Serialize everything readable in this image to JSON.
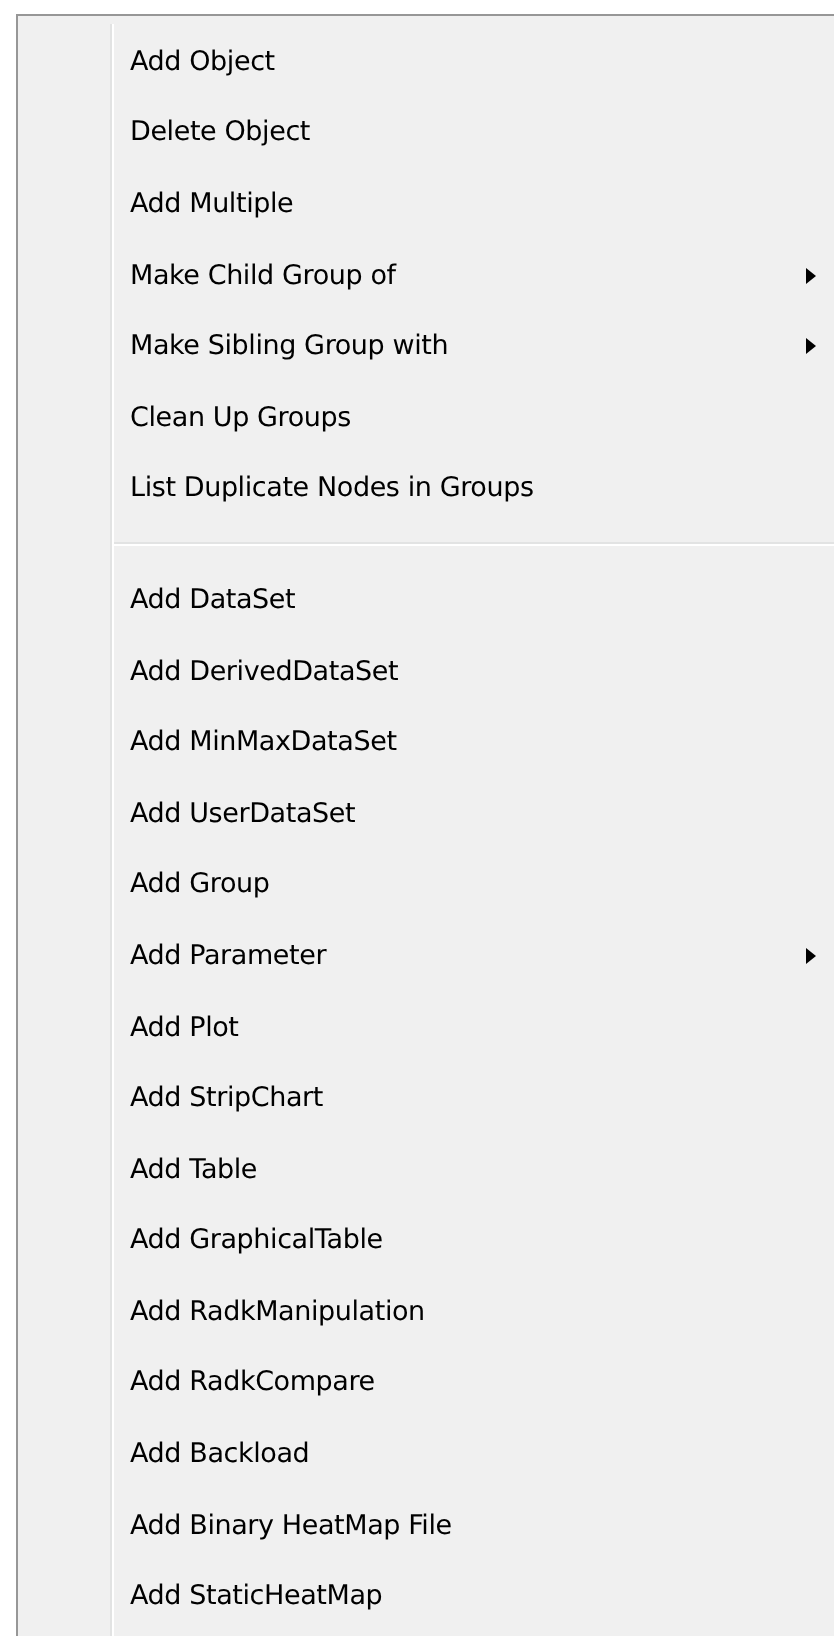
{
  "context_menu": {
    "groups": [
      {
        "items": [
          {
            "label": "Add Object",
            "submenu": false
          },
          {
            "label": "Delete Object",
            "submenu": false
          },
          {
            "label": "Add Multiple",
            "submenu": false
          },
          {
            "label": "Make Child Group of",
            "submenu": true
          },
          {
            "label": "Make Sibling Group with",
            "submenu": true
          },
          {
            "label": "Clean Up Groups",
            "submenu": false
          },
          {
            "label": "List Duplicate Nodes in Groups",
            "submenu": false
          }
        ]
      },
      {
        "items": [
          {
            "label": "Add DataSet",
            "submenu": false
          },
          {
            "label": "Add DerivedDataSet",
            "submenu": false
          },
          {
            "label": "Add MinMaxDataSet",
            "submenu": false
          },
          {
            "label": "Add UserDataSet",
            "submenu": false
          },
          {
            "label": "Add Group",
            "submenu": false
          },
          {
            "label": "Add Parameter",
            "submenu": true
          },
          {
            "label": "Add Plot",
            "submenu": false
          },
          {
            "label": "Add StripChart",
            "submenu": false
          },
          {
            "label": "Add Table",
            "submenu": false
          },
          {
            "label": "Add GraphicalTable",
            "submenu": false
          },
          {
            "label": "Add RadkManipulation",
            "submenu": false
          },
          {
            "label": "Add RadkCompare",
            "submenu": false
          },
          {
            "label": "Add Backload",
            "submenu": false
          },
          {
            "label": "Add Binary HeatMap File",
            "submenu": false
          },
          {
            "label": "Add StaticHeatMap",
            "submenu": false
          }
        ]
      }
    ]
  }
}
